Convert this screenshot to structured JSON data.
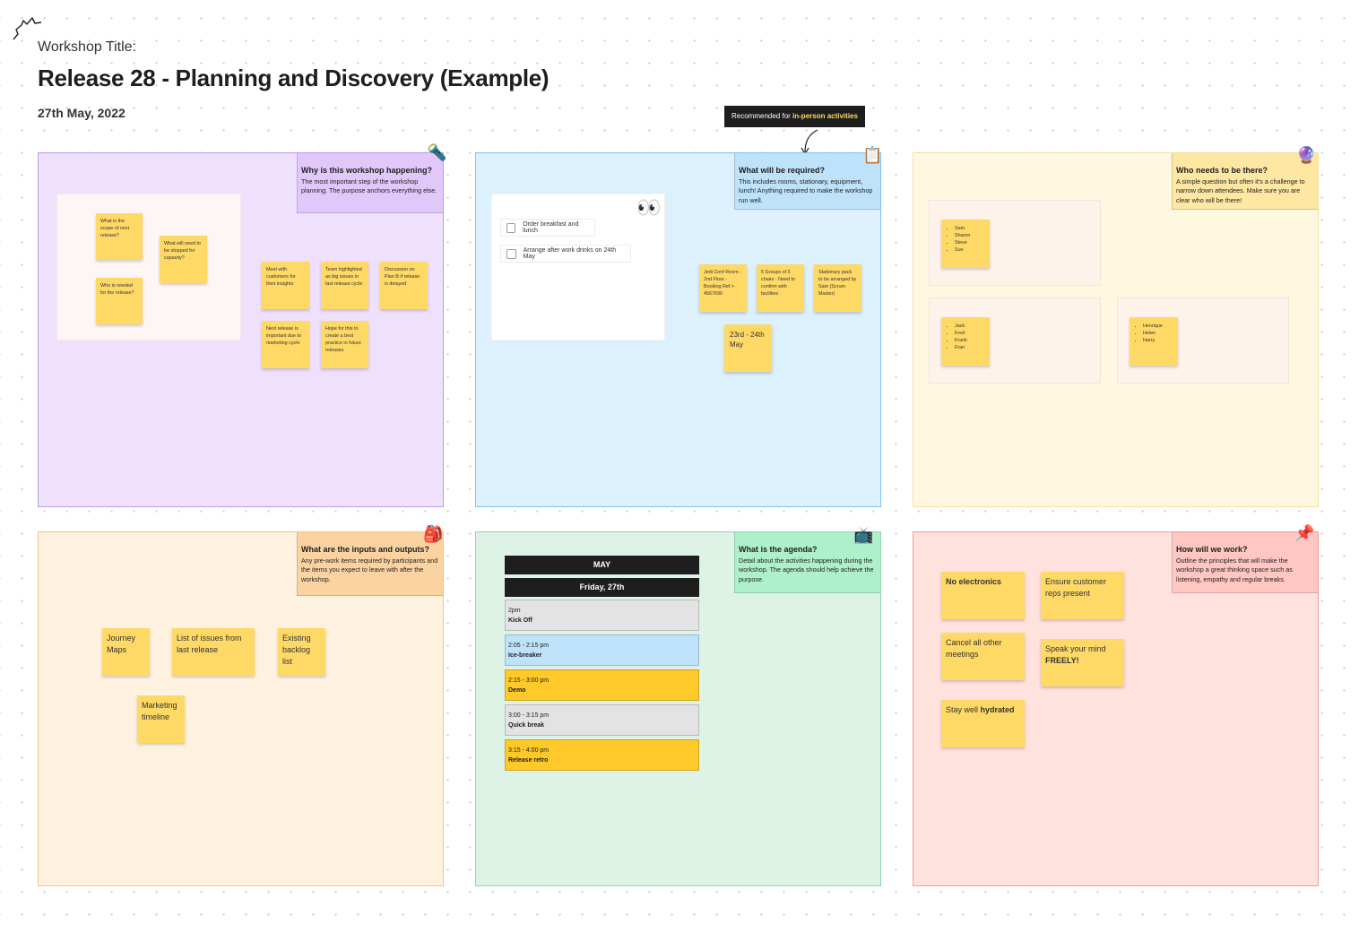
{
  "header": {
    "label": "Workshop Title:",
    "title": "Release 28 - Planning and Discovery (Example)",
    "date": "27th May, 2022"
  },
  "tooltip": {
    "prefix": "Recommended for ",
    "highlight": "in-person activities"
  },
  "sections": {
    "why": {
      "title": "Why is this workshop happening?",
      "body": "The most important step of the workshop planning. The purpose anchors everything else.",
      "icon": "flashlight-icon",
      "panel_stickies": [
        "What is the scope of next release?",
        "What will need to be stopped for capacity?",
        "Who is needed for the release?"
      ],
      "stickies": [
        "Meet with customers for their insights",
        "Team highlighted as big issues in last release cycle",
        "Discussion on Plan B if release is delayed",
        "Next release is important due to marketing cycle",
        "Hope for this to create a best practice in future releases"
      ]
    },
    "required": {
      "title": "What will be required?",
      "body": "This includes rooms, stationary, equipment, lunch! Anything required to make the workshop run well.",
      "icon": "clipboard-icon",
      "checklist": [
        "Order breakfast and lunch",
        "Arrange after work drinks on 24th May"
      ],
      "stickies": [
        "Jedi Conf Room - 2nd Floor - Booking Ref > 4567690",
        "5 Groups of 5 chairs - Need to confirm with facilities",
        "Stationary pack to be arranged by Sam (Scrum Master)"
      ],
      "date_sticky": "23rd - 24th May"
    },
    "who": {
      "title": "Who needs to be there?",
      "body": "A simple question but often it's a challenge to narrow down attendees. Make sure you are clear who will be there!",
      "icon": "crystal-ball-icon",
      "group1": [
        "Sam",
        "Sharon",
        "Steve",
        "Sue"
      ],
      "group2": [
        "Jack",
        "Fred",
        "Frank",
        "Fran"
      ],
      "group3": [
        "Henrique",
        "Helen",
        "Harry"
      ]
    },
    "inputs": {
      "title": "What are the inputs and outputs?",
      "body": "Any pre-work items required by participants and the items you expect to leave with after the workshop.",
      "icon": "backpack-icon",
      "stickies": [
        "Journey Maps",
        "List of issues from last release",
        "Existing backlog list",
        "Marketing timeline"
      ]
    },
    "agenda": {
      "title": "What is the agenda?",
      "body": "Detail about the activities happening during the workshop. The agenda should help achieve the purpose.",
      "icon": "tv-icon",
      "month": "MAY",
      "day": "Friday, 27th",
      "items": [
        {
          "time": "2pm",
          "name": "Kick Off"
        },
        {
          "time": "2:05 - 2:15 pm",
          "name": "Ice-breaker"
        },
        {
          "time": "2:15 - 3:00 pm",
          "name": "Demo"
        },
        {
          "time": "3:00 - 3:15 pm",
          "name": "Quick break"
        },
        {
          "time": "3:15 - 4:00 pm",
          "name": "Release retro"
        }
      ]
    },
    "work": {
      "title": "How will we work?",
      "body": "Outline the principles that will make the workshop a great thinking space such as listening, empathy and regular breaks.",
      "icon": "pushpin-icon",
      "no_electronics": "No electronics",
      "customer_reps": "Ensure customer reps present",
      "cancel": "Cancel all other meetings",
      "speak_prefix": "Speak your mind ",
      "speak_bold": "FREELY!",
      "hydrated_prefix": "Stay well ",
      "hydrated_bold": "hydrated"
    }
  },
  "colors": {
    "sticky": "#ffd966",
    "why_bg": "#efe0fd",
    "why_border": "#b99be8",
    "why_callout": "#e1c8fb",
    "req_bg": "#dcf0fd",
    "req_border": "#7cc4ee",
    "req_callout": "#bfe2fb",
    "who_bg": "#fff8e0",
    "who_border": "#f6df9e",
    "who_callout": "#fde7a3",
    "inp_bg": "#fff1df",
    "inp_border": "#f3c58b",
    "inp_callout": "#fbd3a1",
    "age_bg": "#dcf3e6",
    "age_border": "#8fd3ad",
    "age_callout": "#aef0c9",
    "work_bg": "#ffe2de",
    "work_border": "#f29b93",
    "work_callout": "#ffc6c2",
    "agenda_grey": "#e3e3e3",
    "agenda_blue": "#bfe2fb",
    "agenda_yellow": "#ffc929"
  }
}
